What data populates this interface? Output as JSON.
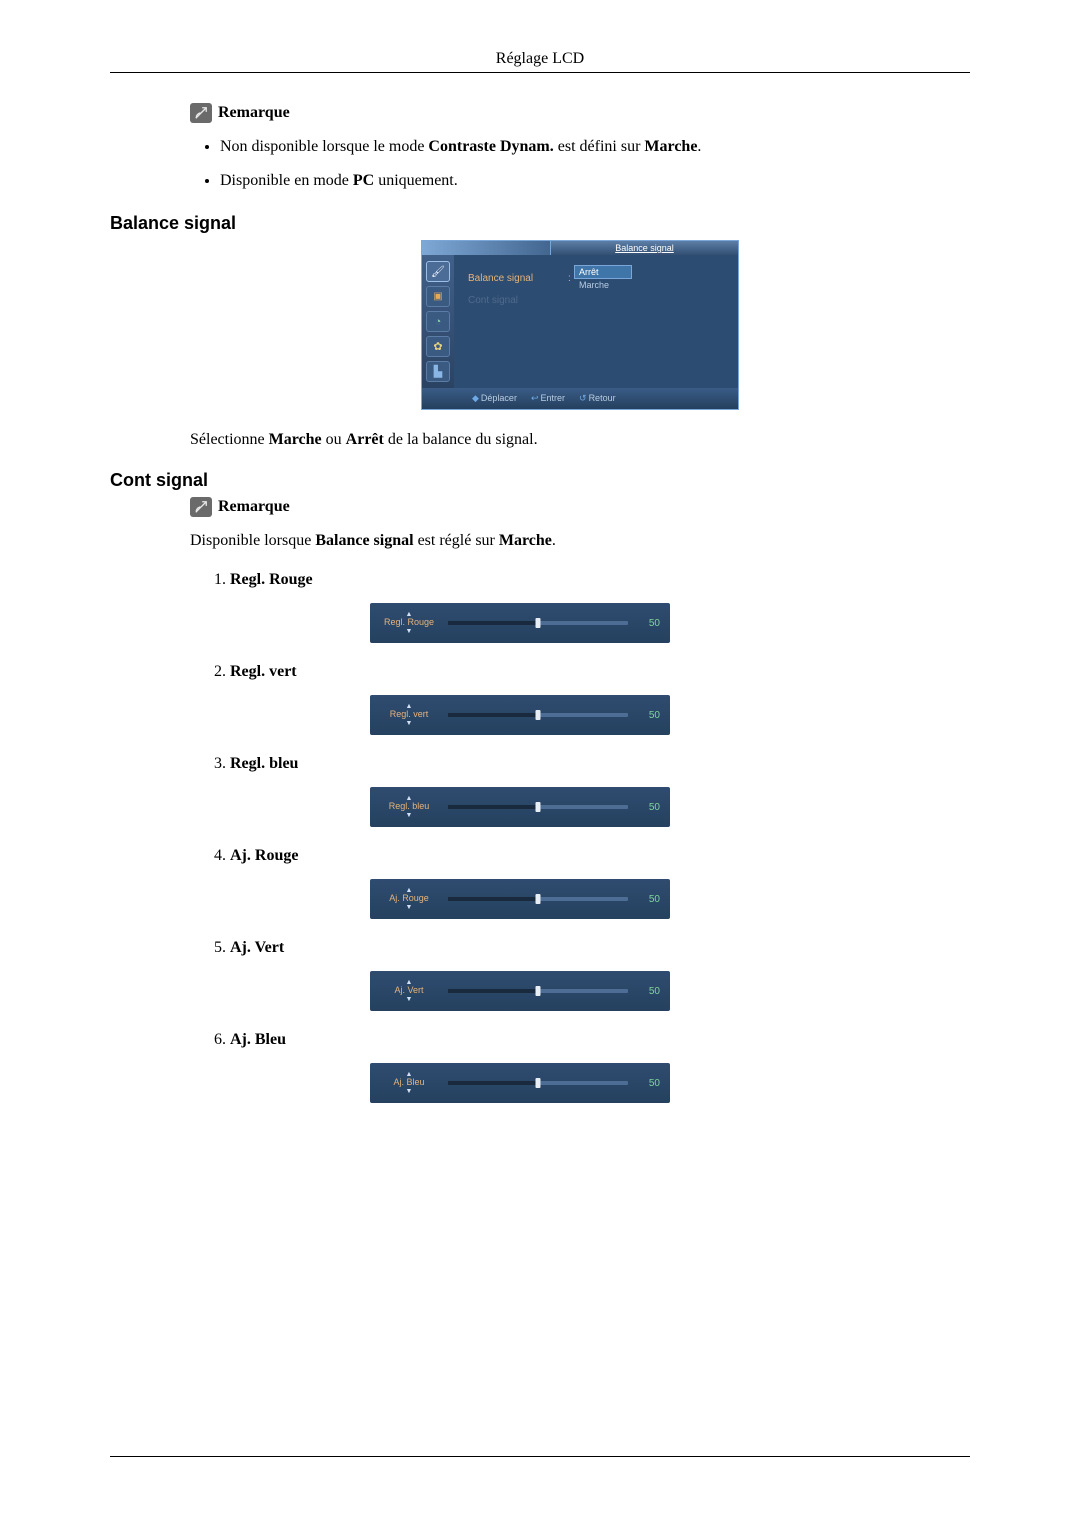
{
  "running_head": "Réglage LCD",
  "remarque_label": "Remarque",
  "notes_top": {
    "item1_pre": "Non disponible lorsque le mode ",
    "item1_b1": "Contraste Dynam.",
    "item1_mid": " est défini sur ",
    "item1_b2": "Marche",
    "item1_post": ".",
    "item2_pre": "Disponible en mode ",
    "item2_b1": "PC",
    "item2_post": " uniquement."
  },
  "sections": {
    "balance_heading": "Balance signal",
    "cont_heading": "Cont signal"
  },
  "osd": {
    "title": "Balance signal",
    "row1_label": "Balance signal",
    "row1_option_off": "Arrêt",
    "row1_option_on": "Marche",
    "row2_label": "Cont signal",
    "footer_move": "Déplacer",
    "footer_enter": "Entrer",
    "footer_return": "Retour"
  },
  "balance_body": {
    "pre": "Sélectionne ",
    "b1": "Marche",
    "mid": " ou ",
    "b2": "Arrêt",
    "post": " de la balance du signal."
  },
  "cont_body": {
    "pre": "Disponible lorsque ",
    "b1": "Balance signal",
    "mid": " est réglé sur ",
    "b2": "Marche",
    "post": "."
  },
  "sliders": [
    {
      "heading": "Regl. Rouge",
      "osd_label": "Regl. Rouge",
      "value": "50"
    },
    {
      "heading": "Regl. vert",
      "osd_label": "Regl. vert",
      "value": "50"
    },
    {
      "heading": "Regl. bleu",
      "osd_label": "Regl. bleu",
      "value": "50"
    },
    {
      "heading": "Aj. Rouge",
      "osd_label": "Aj. Rouge",
      "value": "50"
    },
    {
      "heading": "Aj. Vert",
      "osd_label": "Aj. Vert",
      "value": "50"
    },
    {
      "heading": "Aj. Bleu",
      "osd_label": "Aj. Bleu",
      "value": "50"
    }
  ]
}
